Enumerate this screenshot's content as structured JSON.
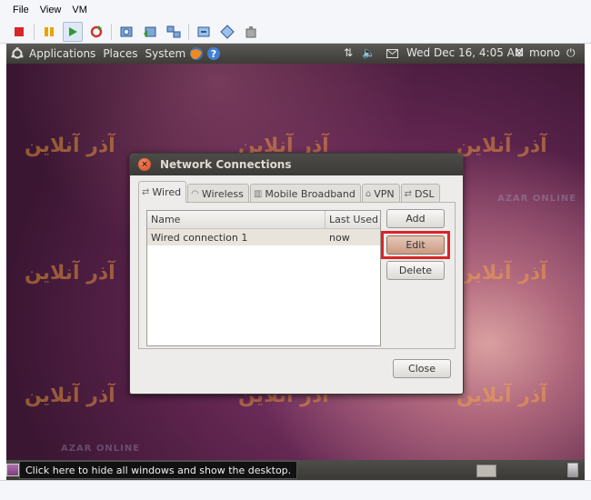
{
  "host": {
    "menu": [
      "File",
      "View",
      "VM"
    ],
    "toolbar_icons": [
      "stop-icon",
      "pause-icon",
      "play-icon",
      "reset-icon",
      "snapshot-icon",
      "revert-snapshot-icon",
      "manage-snapshots-icon",
      "fullscreen-icon",
      "unity-icon",
      "preferences-icon"
    ]
  },
  "panel": {
    "menus": [
      "Applications",
      "Places",
      "System"
    ],
    "clock": "Wed Dec 16,  4:05 AM",
    "user": "mono"
  },
  "dialog": {
    "title": "Network Connections",
    "close_glyph": "×",
    "tabs": [
      "Wired",
      "Wireless",
      "Mobile Broadband",
      "VPN",
      "DSL"
    ],
    "columns": [
      "Name",
      "Last Used"
    ],
    "rows": [
      {
        "name": "Wired connection 1",
        "last_used": "now"
      }
    ],
    "buttons": {
      "add": "Add",
      "edit": "Edit",
      "delete": "Delete",
      "close": "Close"
    }
  },
  "bottom": {
    "tooltip": "Click here to hide all windows and show the desktop."
  },
  "watermark": {
    "logo_text": "آذر آنلاین",
    "sub_text": "AZAR ONLINE"
  },
  "colors": {
    "highlight": "#d9252a",
    "dialog_bg": "#edeceb",
    "titlebar": "#3c3b37"
  }
}
